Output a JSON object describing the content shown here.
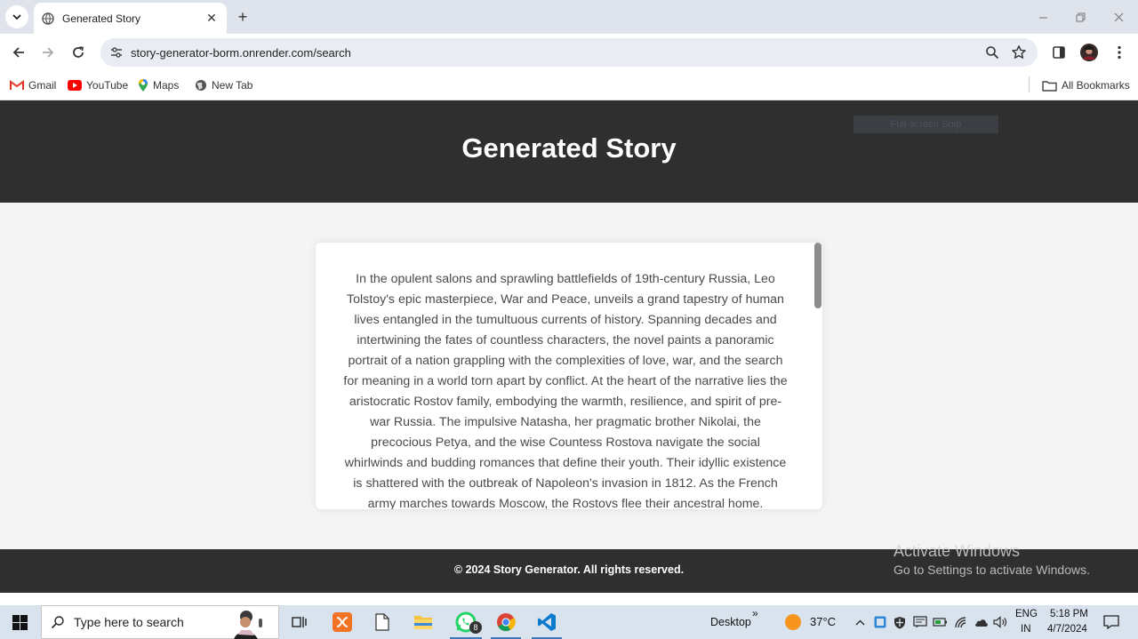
{
  "browser": {
    "tab_title": "Generated Story",
    "new_tab_symbol": "+",
    "close_symbol": "✕",
    "url": "story-generator-borm.onrender.com/search",
    "bookmarks": [
      {
        "label": "Gmail",
        "icon": "gmail-icon"
      },
      {
        "label": "YouTube",
        "icon": "youtube-icon"
      },
      {
        "label": "Maps",
        "icon": "maps-icon"
      },
      {
        "label": "New Tab",
        "icon": "globe-icon"
      }
    ],
    "all_bookmarks_label": "All Bookmarks"
  },
  "page": {
    "title": "Generated Story",
    "snip_overlay": "Full-screen Snip",
    "story": "In the opulent salons and sprawling battlefields of 19th-century Russia, Leo Tolstoy's epic masterpiece, War and Peace, unveils a grand tapestry of human lives entangled in the tumultuous currents of history. Spanning decades and intertwining the fates of countless characters, the novel paints a panoramic portrait of a nation grappling with the complexities of love, war, and the search for meaning in a world torn apart by conflict. At the heart of the narrative lies the aristocratic Rostov family, embodying the warmth, resilience, and spirit of pre-war Russia. The impulsive Natasha, her pragmatic brother Nikolai, the precocious Petya, and the wise Countess Rostova navigate the social whirlwinds and budding romances that define their youth. Their idyllic existence is shattered with the outbreak of Napoleon's invasion in 1812. As the French army marches towards Moscow, the Rostovs flee their ancestral home.",
    "footer": "© 2024 Story Generator. All rights reserved."
  },
  "watermark": {
    "line1": "Activate Windows",
    "line2": "Go to Settings to activate Windows."
  },
  "taskbar": {
    "search_placeholder": "Type here to search",
    "whatsapp_badge": "8",
    "desktop_label": "Desktop",
    "chevron": "»",
    "temperature": "37°C",
    "lang_top": "ENG",
    "lang_bottom": "IN",
    "time": "5:18 PM",
    "date": "4/7/2024"
  },
  "colors": {
    "header_bg": "#2f2f2f",
    "page_bg": "#f4f4f4",
    "tabstrip_bg": "#dfe3eb",
    "taskbar_bg": "#d9e3ee"
  }
}
